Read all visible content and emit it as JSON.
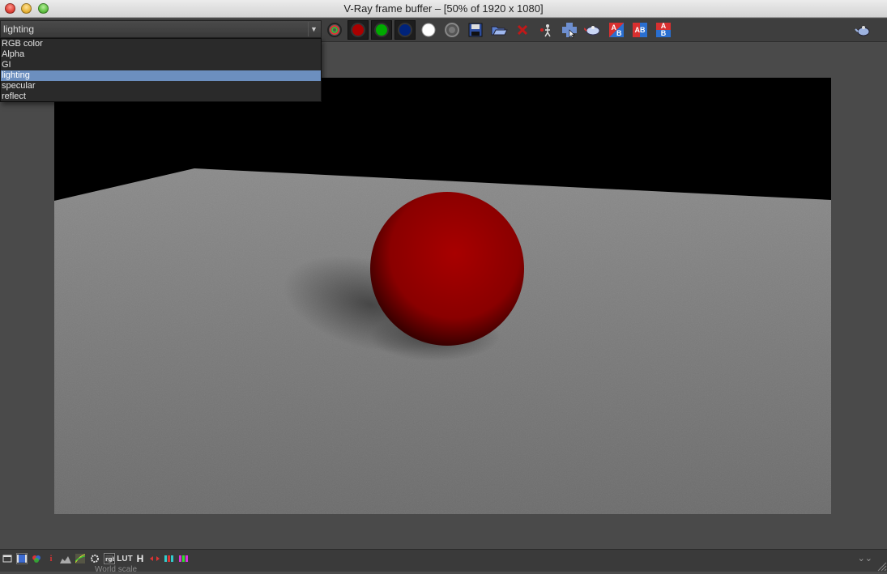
{
  "window": {
    "title": "V-Ray frame buffer – [50% of 1920 x 1080]"
  },
  "toolbar": {
    "channel_value": "lighting",
    "buttons": [
      "rgb-channels-icon",
      "red-channel-icon",
      "green-channel-icon",
      "blue-channel-icon",
      "alpha-channel-icon",
      "monochrome-icon",
      "save-icon",
      "open-icon",
      "clear-icon",
      "track-mouse-icon",
      "region-render-icon",
      "render-icon",
      "ab-compare-horizontal-icon",
      "ab-compare-icon",
      "ab-compare-vertical-icon"
    ],
    "ab_label": "A",
    "b_label": "B"
  },
  "channels": {
    "options": [
      "RGB color",
      "Alpha",
      "GI",
      "lighting",
      "specular",
      "reflect"
    ],
    "selected": "lighting"
  },
  "status": {
    "world_scale": "World scale",
    "lut_label": "LUT",
    "h_label": "H",
    "info_label": "i"
  },
  "colors": {
    "accent": "#6c8fbf",
    "sphere": "#9a0000"
  }
}
